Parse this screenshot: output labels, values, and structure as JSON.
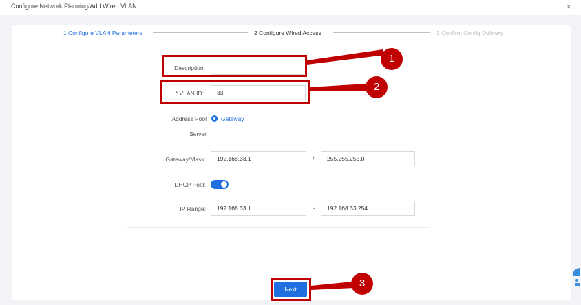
{
  "dialog": {
    "title": "Configure Network Planning/Add Wired VLAN",
    "close_symbol": "×"
  },
  "steps": [
    {
      "label": "1 Configure VLAN Parameters",
      "state": "active"
    },
    {
      "label": "2 Configure Wired Access",
      "state": "upcoming"
    },
    {
      "label": "3 Confirm Config Delivery",
      "state": "disabled"
    }
  ],
  "form": {
    "description": {
      "label": "Description:",
      "value": ""
    },
    "vlan_id": {
      "label": "* VLAN ID:",
      "value": "33"
    },
    "address_pool": {
      "label_line1": "Address Pool",
      "label_line2": "Server",
      "option": "Gateway",
      "selected": true
    },
    "gateway_mask": {
      "label": "Gateway/Mask:",
      "gateway": "192.168.33.1",
      "separator": "/",
      "mask": "255.255.255.0"
    },
    "dhcp_pool": {
      "label": "DHCP Pool:",
      "enabled": true
    },
    "ip_range": {
      "label": "IP Range:",
      "start": "192.168.33.1",
      "separator": "-",
      "end": "192.168.33.254"
    }
  },
  "buttons": {
    "next_label": "Next"
  },
  "callouts": [
    "1",
    "2",
    "3"
  ],
  "colors": {
    "accent": "#1f6fe0",
    "callout_red": "#c00000"
  }
}
